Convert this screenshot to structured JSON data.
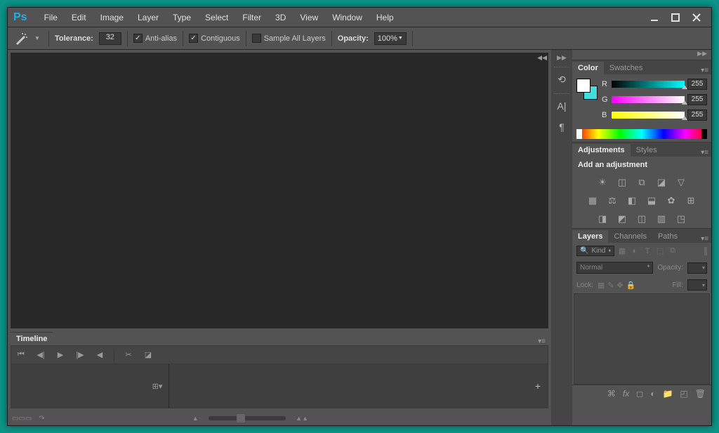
{
  "app": {
    "logo": "Ps"
  },
  "menubar": [
    "File",
    "Edit",
    "Image",
    "Layer",
    "Type",
    "Select",
    "Filter",
    "3D",
    "View",
    "Window",
    "Help"
  ],
  "options": {
    "tolerance_label": "Tolerance:",
    "tolerance_value": "32",
    "antialias_label": "Anti-alias",
    "contiguous_label": "Contiguous",
    "sample_all_label": "Sample All Layers",
    "opacity_label": "Opacity:",
    "opacity_value": "100%"
  },
  "timeline": {
    "tab": "Timeline"
  },
  "color_panel": {
    "tabs": [
      "Color",
      "Swatches"
    ],
    "r_label": "R",
    "g_label": "G",
    "b_label": "B",
    "r_value": "255",
    "g_value": "255",
    "b_value": "255"
  },
  "adjustments_panel": {
    "tabs": [
      "Adjustments",
      "Styles"
    ],
    "title": "Add an adjustment"
  },
  "layers_panel": {
    "tabs": [
      "Layers",
      "Channels",
      "Paths"
    ],
    "kind_label": "Kind",
    "blend_mode": "Normal",
    "opacity_label": "Opacity:",
    "lock_label": "Lock:",
    "fill_label": "Fill:"
  }
}
